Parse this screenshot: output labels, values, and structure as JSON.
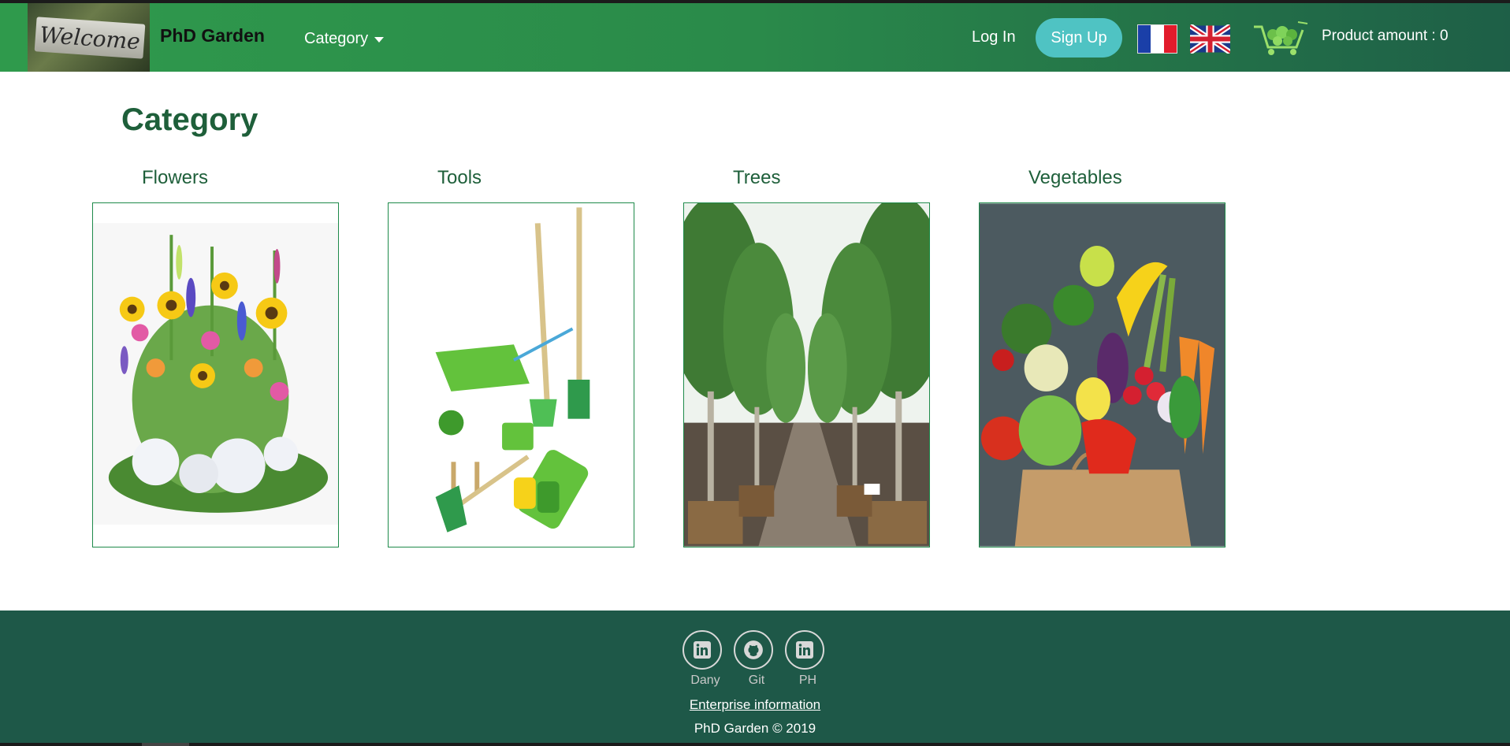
{
  "navbar": {
    "logo_text": "Welcome",
    "brand": "PhD Garden",
    "category_menu": "Category",
    "login": "Log In",
    "signup": "Sign Up",
    "language_fr_icon": "france-flag-icon",
    "language_en_icon": "uk-flag-icon",
    "cart_icon": "shopping-cart-icon",
    "product_amount": "Product amount : 0"
  },
  "main": {
    "title": "Category",
    "categories": [
      {
        "label": "Flowers",
        "image": "flowers-image"
      },
      {
        "label": "Tools",
        "image": "tools-image"
      },
      {
        "label": "Trees",
        "image": "trees-image"
      },
      {
        "label": "Vegetables",
        "image": "vegetables-image"
      }
    ]
  },
  "footer": {
    "social": [
      {
        "label": "Dany",
        "icon": "linkedin-icon"
      },
      {
        "label": "Git",
        "icon": "github-icon"
      },
      {
        "label": "PH",
        "icon": "linkedin-icon"
      }
    ],
    "enterprise_link": "Enterprise information",
    "copyright": "PhD Garden © 2019"
  },
  "colors": {
    "nav_start": "#2f9a4c",
    "nav_end": "#1e5f47",
    "heading_green": "#1e5f3a",
    "signup_bg": "#4fc3c3",
    "footer_bg": "#1e5848"
  }
}
